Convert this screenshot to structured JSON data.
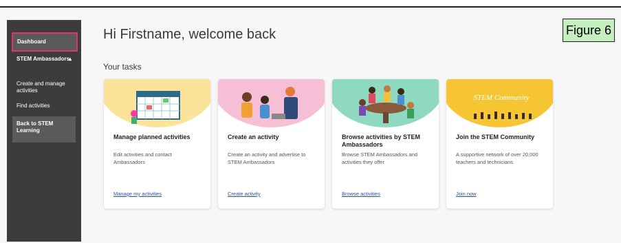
{
  "sidebar": {
    "items": [
      {
        "label": "Dashboard"
      },
      {
        "label": "STEM Ambassadors"
      },
      {
        "label": "Create and manage activities"
      },
      {
        "label": "Find activities"
      },
      {
        "label": "Back to STEM Learning"
      }
    ]
  },
  "main": {
    "greeting": "Hi Firstname, welcome back",
    "tasks_heading": "Your tasks"
  },
  "figure_label": "Figure 6",
  "cards": [
    {
      "title": "Manage planned activities",
      "description": "Edit activities and contact Ambassadors",
      "link": "Manage my activities",
      "color": "#fbe39a"
    },
    {
      "title": "Create an activity",
      "description": "Create an activity and advertise to STEM Ambassadors",
      "link": "Create activity",
      "color": "#f6bfd6"
    },
    {
      "title": "Browse activities by STEM Ambassadors",
      "description": "Browse STEM Ambassadors and activities they offer",
      "link": "Browse activities",
      "color": "#8fd9c0"
    },
    {
      "title": "Join the STEM Community",
      "description": "A supportive network of over 20,000 teachers and technicians",
      "link": "Join now",
      "color": "#f5c533",
      "art_text": "STEM Community"
    }
  ],
  "colors": {
    "sidebar_bg": "#3c3c3b",
    "highlight_border": "#e0317f",
    "link": "#2a52a8",
    "figure_tag_bg": "#c6efc0"
  }
}
